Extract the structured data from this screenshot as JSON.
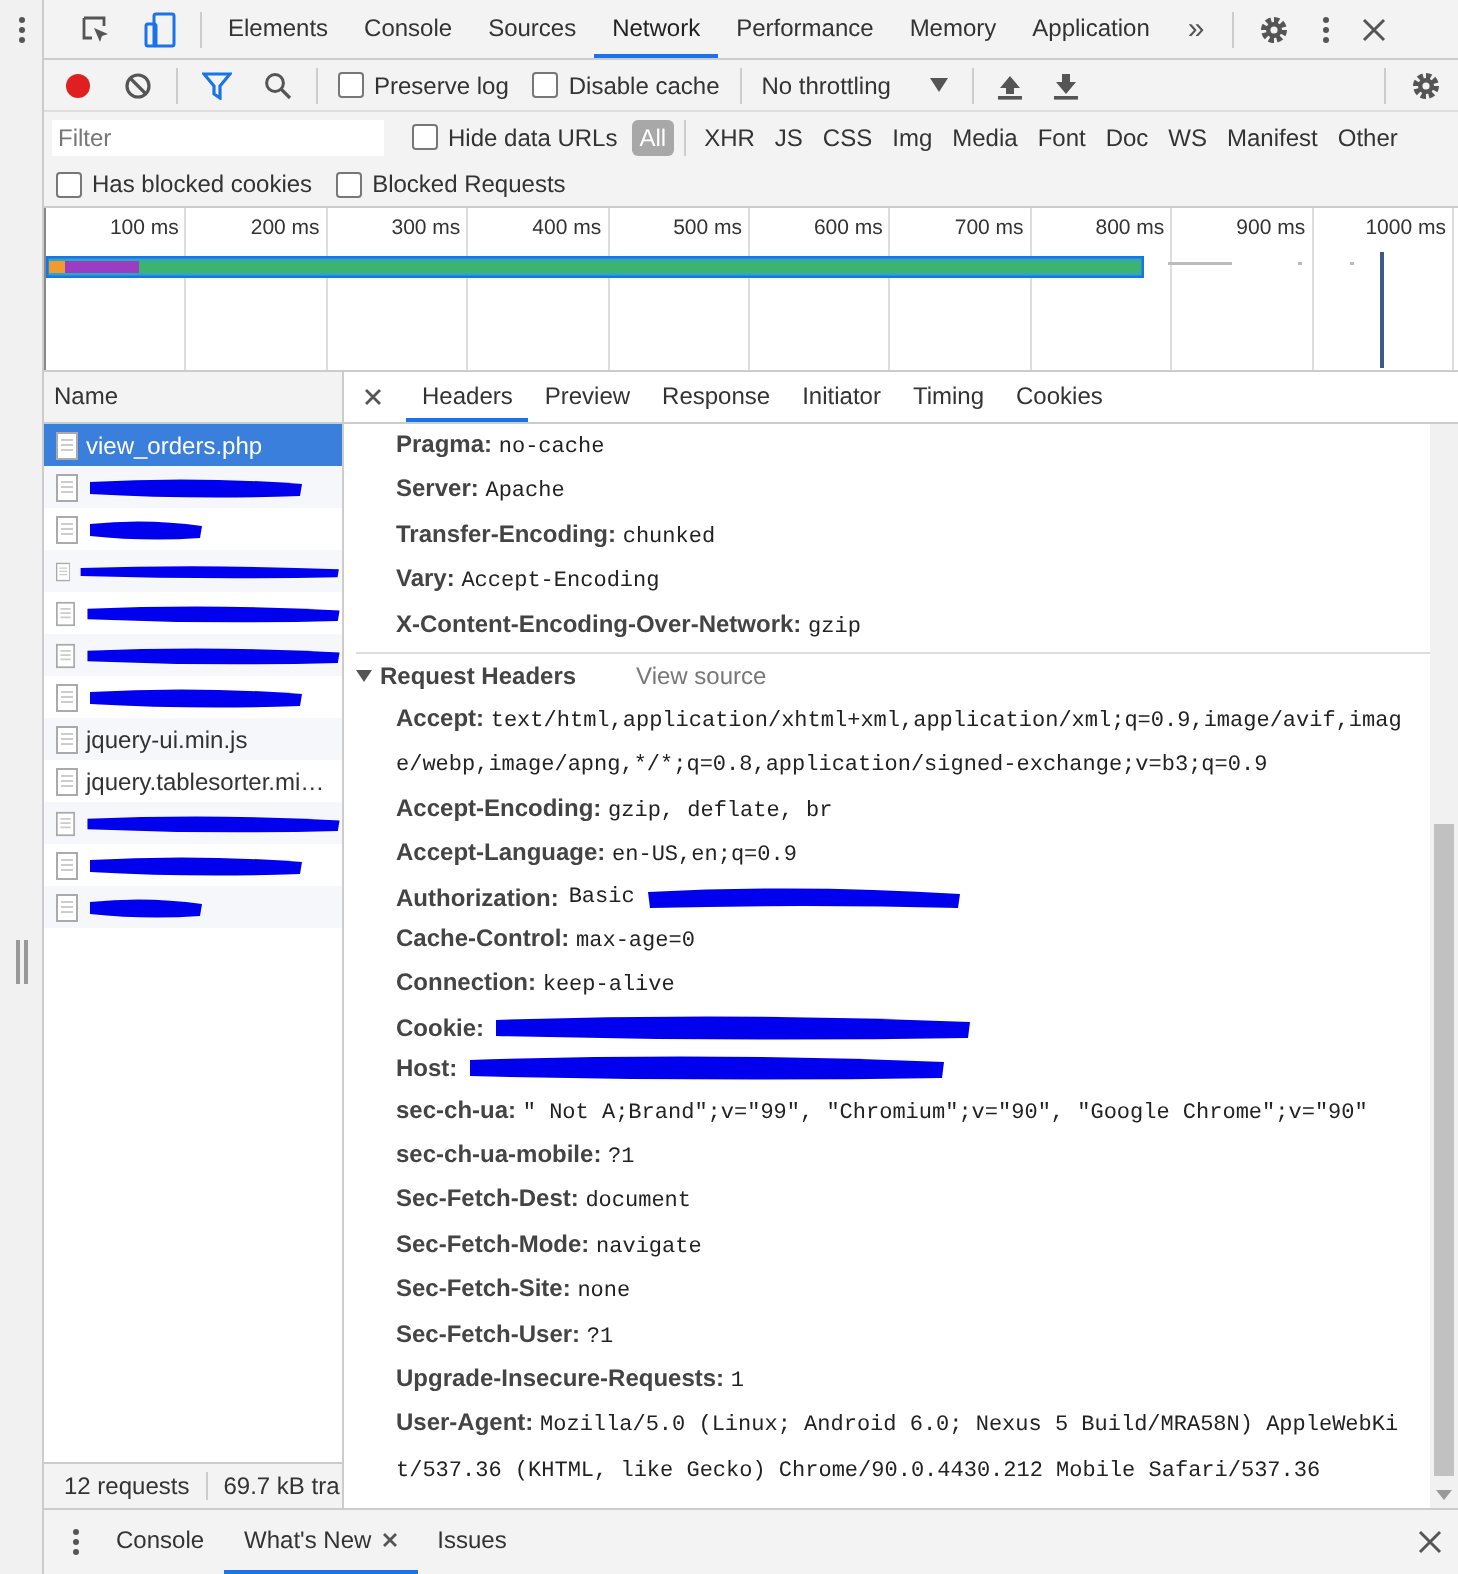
{
  "main_tabs": [
    {
      "label": "Elements",
      "selected": false
    },
    {
      "label": "Console",
      "selected": false
    },
    {
      "label": "Sources",
      "selected": false
    },
    {
      "label": "Network",
      "selected": true
    },
    {
      "label": "Performance",
      "selected": false
    },
    {
      "label": "Memory",
      "selected": false
    },
    {
      "label": "Application",
      "selected": false
    }
  ],
  "more_tabs": "»",
  "toolbar": {
    "recording": true,
    "filter_on": true,
    "throttling": "No throttling",
    "checkboxes": [
      {
        "label": "Preserve log",
        "checked": false
      },
      {
        "label": "Disable cache",
        "checked": false
      }
    ]
  },
  "filter_bar": {
    "placeholder": "Filter",
    "hide_data_urls": {
      "label": "Hide data URLs",
      "checked": false
    },
    "types": [
      {
        "label": "All",
        "selected": true
      },
      {
        "label": "XHR",
        "selected": false
      },
      {
        "label": "JS",
        "selected": false
      },
      {
        "label": "CSS",
        "selected": false
      },
      {
        "label": "Img",
        "selected": false
      },
      {
        "label": "Media",
        "selected": false
      },
      {
        "label": "Font",
        "selected": false
      },
      {
        "label": "Doc",
        "selected": false
      },
      {
        "label": "WS",
        "selected": false
      },
      {
        "label": "Manifest",
        "selected": false
      },
      {
        "label": "Other",
        "selected": false
      }
    ]
  },
  "blocked_options": [
    {
      "label": "Has blocked cookies",
      "checked": false
    },
    {
      "label": "Blocked Requests",
      "checked": false
    }
  ],
  "overview": {
    "ticks": [
      "100 ms",
      "200 ms",
      "300 ms",
      "400 ms",
      "500 ms",
      "600 ms",
      "700 ms",
      "800 ms",
      "900 ms",
      "1000 ms"
    ]
  },
  "requests": {
    "column": "Name",
    "rows": [
      {
        "name": "view_orders.php",
        "selected": true,
        "redacted": false
      },
      {
        "selected": false,
        "redacted": true
      },
      {
        "selected": false,
        "redacted": true
      },
      {
        "selected": false,
        "redacted": true
      },
      {
        "selected": false,
        "redacted": true
      },
      {
        "selected": false,
        "redacted": true
      },
      {
        "selected": false,
        "redacted": true
      },
      {
        "name": "jquery-ui.min.js",
        "selected": false,
        "redacted": false
      },
      {
        "name": "jquery.tablesorter.mi…",
        "selected": false,
        "redacted": false
      },
      {
        "selected": false,
        "redacted": true
      },
      {
        "selected": false,
        "redacted": true
      },
      {
        "selected": false,
        "redacted": true
      }
    ]
  },
  "status": [
    "12 requests",
    "69.7 kB tra"
  ],
  "details": {
    "tabs": [
      {
        "label": "Headers",
        "selected": true
      },
      {
        "label": "Preview",
        "selected": false
      },
      {
        "label": "Response",
        "selected": false
      },
      {
        "label": "Initiator",
        "selected": false
      },
      {
        "label": "Timing",
        "selected": false
      },
      {
        "label": "Cookies",
        "selected": false
      }
    ],
    "response_headers": [
      {
        "name": "Pragma:",
        "value": "no-cache"
      },
      {
        "name": "Server:",
        "value": "Apache"
      },
      {
        "name": "Transfer-Encoding:",
        "value": "chunked"
      },
      {
        "name": "Vary:",
        "value": "Accept-Encoding"
      },
      {
        "name": "X-Content-Encoding-Over-Network:",
        "value": "gzip"
      }
    ],
    "request_section": {
      "title": "Request Headers",
      "expanded": true,
      "link": "View source"
    },
    "request_headers": [
      {
        "name": "Accept:",
        "value": "text/html,application/xhtml+xml,application/xml;q=0.9,image/avif,image/webp,image/apng,*/*;q=0.8,application/signed-exchange;v=b3;q=0.9",
        "redacted": false
      },
      {
        "name": "Accept-Encoding:",
        "value": "gzip, deflate, br",
        "redacted": false
      },
      {
        "name": "Accept-Language:",
        "value": "en-US,en;q=0.9",
        "redacted": false
      },
      {
        "name": "Authorization:",
        "value": "Basic",
        "redacted": true
      },
      {
        "name": "Cache-Control:",
        "value": "max-age=0",
        "redacted": false
      },
      {
        "name": "Connection:",
        "value": "keep-alive",
        "redacted": false
      },
      {
        "name": "Cookie:",
        "redacted": true
      },
      {
        "name": "Host:",
        "redacted": true
      },
      {
        "name": "sec-ch-ua:",
        "value": "\" Not A;Brand\";v=\"99\", \"Chromium\";v=\"90\", \"Google Chrome\";v=\"90\"",
        "redacted": false
      },
      {
        "name": "sec-ch-ua-mobile:",
        "value": "?1",
        "redacted": false
      },
      {
        "name": "Sec-Fetch-Dest:",
        "value": "document",
        "redacted": false
      },
      {
        "name": "Sec-Fetch-Mode:",
        "value": "navigate",
        "redacted": false
      },
      {
        "name": "Sec-Fetch-Site:",
        "value": "none",
        "redacted": false
      },
      {
        "name": "Sec-Fetch-User:",
        "value": "?1",
        "redacted": false
      },
      {
        "name": "Upgrade-Insecure-Requests:",
        "value": "1",
        "redacted": false
      },
      {
        "name": "User-Agent:",
        "value": "Mozilla/5.0 (Linux; Android 6.0; Nexus 5 Build/MRA58N) AppleWebKit/537.36 (KHTML, like Gecko) Chrome/90.0.4430.212 Mobile Safari/537.36",
        "redacted": false
      }
    ]
  },
  "drawer": {
    "tabs": [
      {
        "label": "Console",
        "selected": false,
        "closable": false
      },
      {
        "label": "What's New",
        "selected": true,
        "closable": true
      },
      {
        "label": "Issues",
        "selected": false,
        "closable": false
      }
    ]
  }
}
